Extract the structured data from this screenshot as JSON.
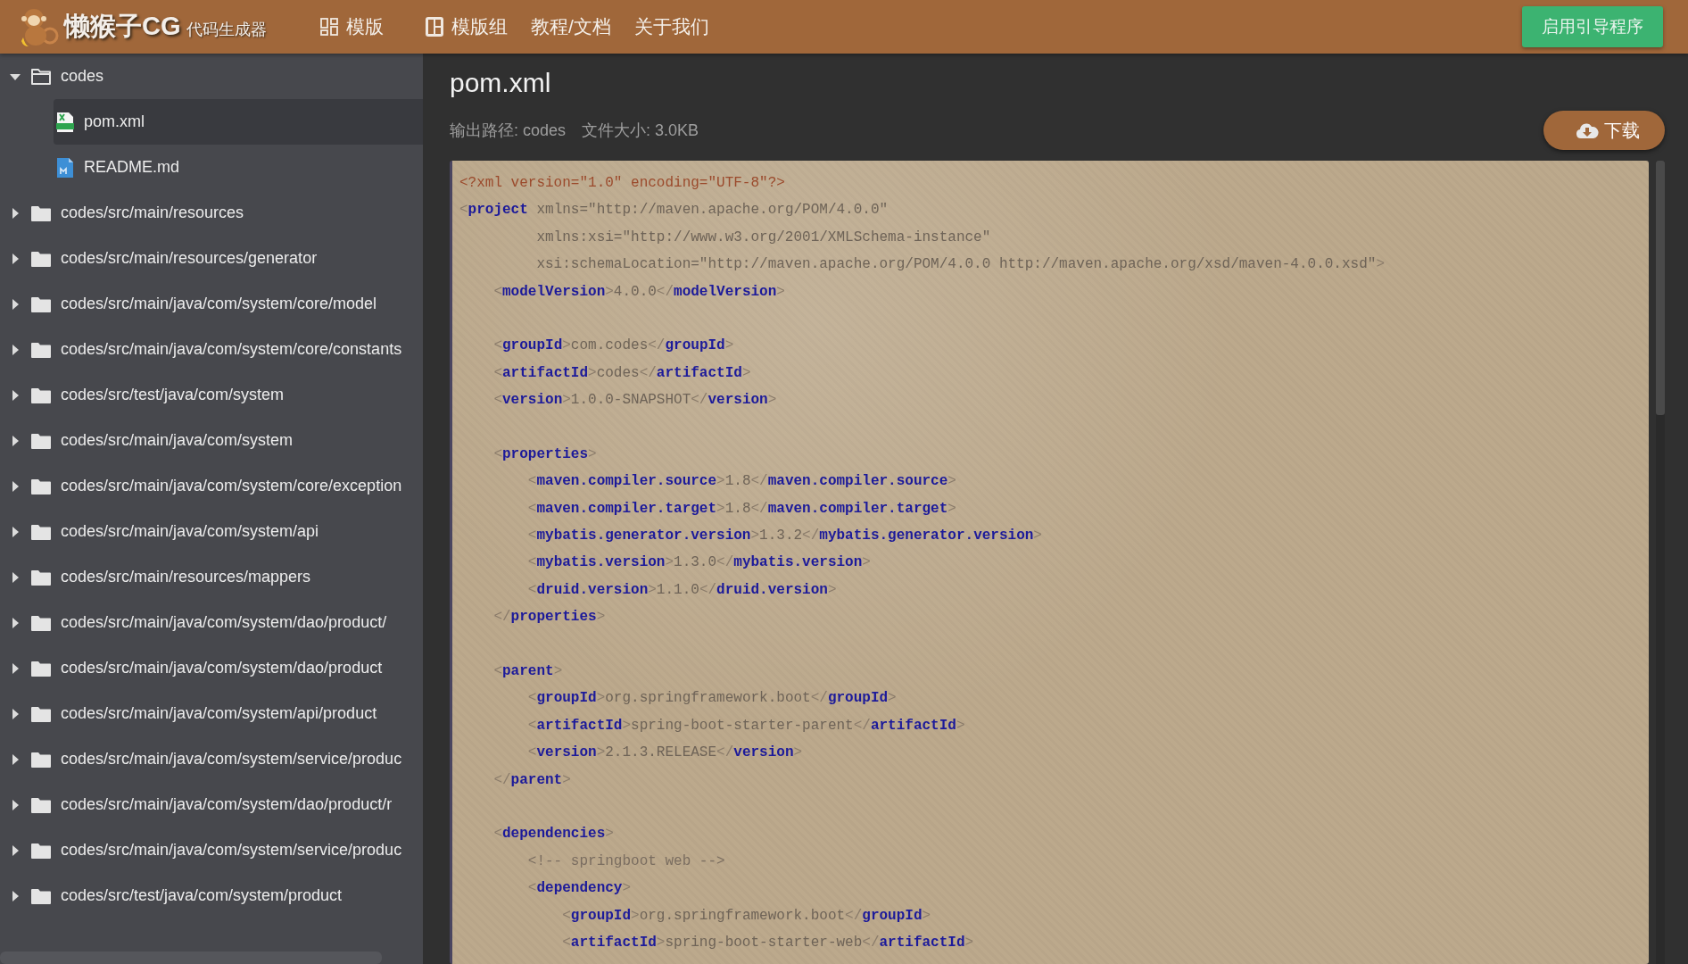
{
  "header": {
    "brand": "懒猴子CG",
    "brand_sub": "代码生成器",
    "nav": [
      {
        "label": "模版",
        "kind": "grid"
      },
      {
        "label": "模版组",
        "kind": "board"
      },
      {
        "label": "教程/文档",
        "kind": "text"
      },
      {
        "label": "关于我们",
        "kind": "text"
      }
    ],
    "guide_button": "启用引导程序"
  },
  "tree": [
    {
      "name": "codes",
      "kind": "folder",
      "expanded": true,
      "children": [
        {
          "name": "pom.xml",
          "kind": "xml",
          "selected": true
        },
        {
          "name": "README.md",
          "kind": "md",
          "selected": false
        }
      ]
    },
    {
      "name": "codes/src/main/resources",
      "kind": "folder",
      "expanded": false
    },
    {
      "name": "codes/src/main/resources/generator",
      "kind": "folder",
      "expanded": false
    },
    {
      "name": "codes/src/main/java/com/system/core/model",
      "kind": "folder",
      "expanded": false
    },
    {
      "name": "codes/src/main/java/com/system/core/constants",
      "kind": "folder",
      "expanded": false
    },
    {
      "name": "codes/src/test/java/com/system",
      "kind": "folder",
      "expanded": false
    },
    {
      "name": "codes/src/main/java/com/system",
      "kind": "folder",
      "expanded": false
    },
    {
      "name": "codes/src/main/java/com/system/core/exception",
      "kind": "folder",
      "expanded": false
    },
    {
      "name": "codes/src/main/java/com/system/api",
      "kind": "folder",
      "expanded": false
    },
    {
      "name": "codes/src/main/resources/mappers",
      "kind": "folder",
      "expanded": false
    },
    {
      "name": "codes/src/main/java/com/system/dao/product/",
      "kind": "folder",
      "expanded": false
    },
    {
      "name": "codes/src/main/java/com/system/dao/product",
      "kind": "folder",
      "expanded": false
    },
    {
      "name": "codes/src/main/java/com/system/api/product",
      "kind": "folder",
      "expanded": false
    },
    {
      "name": "codes/src/main/java/com/system/service/produc",
      "kind": "folder",
      "expanded": false
    },
    {
      "name": "codes/src/main/java/com/system/dao/product/r",
      "kind": "folder",
      "expanded": false
    },
    {
      "name": "codes/src/main/java/com/system/service/produc",
      "kind": "folder",
      "expanded": false
    },
    {
      "name": "codes/src/test/java/com/system/product",
      "kind": "folder",
      "expanded": false
    }
  ],
  "file": {
    "title": "pom.xml",
    "output_path": "输出路径: codes",
    "file_size": "文件大小: 3.0KB",
    "download_button": "下载",
    "code_blocks": [
      [
        "<?xml version=\"1.0\" encoding=\"UTF-8\"?>",
        "<project xmlns=\"http://maven.apache.org/POM/4.0.0\"",
        "         xmlns:xsi=\"http://www.w3.org/2001/XMLSchema-instance\"",
        "         xsi:schemaLocation=\"http://maven.apache.org/POM/4.0.0 http://maven.apache.org/xsd/maven-4.0.0.xsd\">",
        "    <modelVersion>4.0.0</modelVersion>"
      ],
      [
        "    <groupId>com.codes</groupId>",
        "    <artifactId>codes</artifactId>",
        "    <version>1.0.0-SNAPSHOT</version>"
      ],
      [
        "    <properties>",
        "        <maven.compiler.source>1.8</maven.compiler.source>",
        "        <maven.compiler.target>1.8</maven.compiler.target>",
        "        <mybatis.generator.version>1.3.2</mybatis.generator.version>",
        "        <mybatis.version>1.3.0</mybatis.version>",
        "        <druid.version>1.1.0</druid.version>",
        "    </properties>"
      ],
      [
        "    <parent>",
        "        <groupId>org.springframework.boot</groupId>",
        "        <artifactId>spring-boot-starter-parent</artifactId>",
        "        <version>2.1.3.RELEASE</version>",
        "    </parent>"
      ],
      [
        "    <dependencies>",
        "        <!-- springboot web -->",
        "        <dependency>",
        "            <groupId>org.springframework.boot</groupId>",
        "            <artifactId>spring-boot-starter-web</artifactId>"
      ]
    ]
  }
}
